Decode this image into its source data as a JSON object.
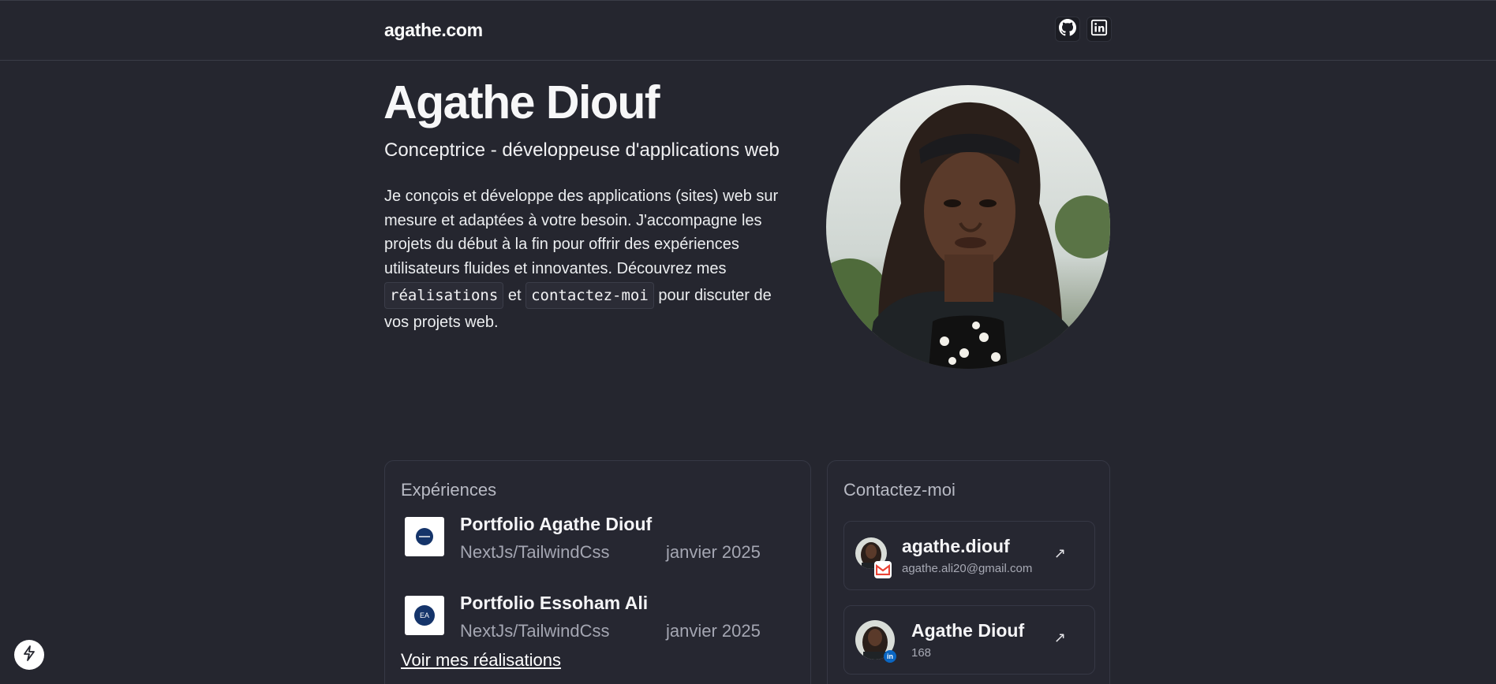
{
  "header": {
    "brand": "agathe.com",
    "social": [
      {
        "icon": "github-icon"
      },
      {
        "icon": "linkedin-icon"
      }
    ]
  },
  "hero": {
    "name": "Agathe Diouf",
    "role": "Conceptrice - développeuse d'applications web",
    "desc_part1": "Je conçois et développe des applications (sites) web sur mesure et adaptées à votre besoin. J'accompagne les projets du début à la fin pour offrir des expériences utilisateurs fluides et innovantes. Découvrez mes ",
    "chip_realisations": "réalisations",
    "desc_et": " et ",
    "chip_contact": "contactez-moi",
    "desc_part2": " pour discuter de vos projets web."
  },
  "experiences": {
    "title": "Expériences",
    "items": [
      {
        "title": "Portfolio Agathe Diouf",
        "tech": "NextJs/TailwindCss",
        "date": "janvier 2025",
        "logo_text": ""
      },
      {
        "title": "Portfolio Essoham Ali",
        "tech": "NextJs/TailwindCss",
        "date": "janvier 2025",
        "logo_text": "EA"
      }
    ],
    "link": "Voir mes réalisations"
  },
  "contact": {
    "title": "Contactez-moi",
    "items": [
      {
        "title": "agathe.diouf",
        "sub": "agathe.ali20@gmail.com",
        "badge_icon": "gmail-icon",
        "arrow": "↗"
      },
      {
        "title": "Agathe Diouf",
        "sub": "168",
        "badge_icon": "linkedin-icon",
        "arrow": "↗"
      }
    ]
  },
  "colors": {
    "background": "#25262f",
    "card_border": "#363845",
    "linkedin": "#0a66c2",
    "gmail": "#ea4335"
  }
}
